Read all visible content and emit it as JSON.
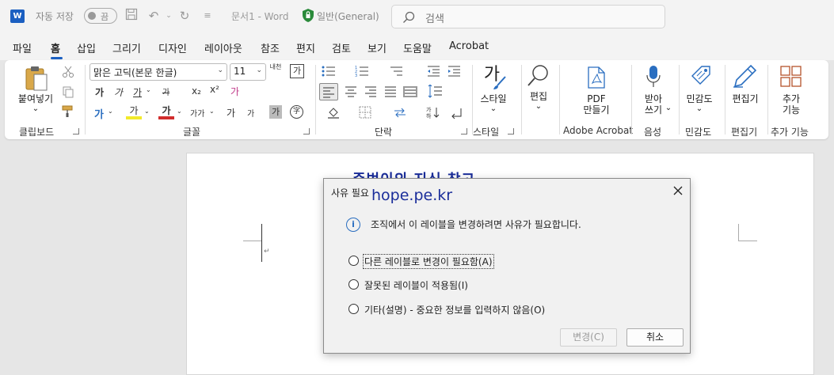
{
  "titlebar": {
    "app_icon_letter": "W",
    "autosave_label": "자동 저장",
    "autosave_state": "끔",
    "doc_title": "문서1 - Word",
    "sensitivity_label": "일반(General)",
    "search_placeholder": "검색"
  },
  "menu": {
    "tabs": [
      "파일",
      "홈",
      "삽입",
      "그리기",
      "디자인",
      "레이아웃",
      "참조",
      "편지",
      "검토",
      "보기",
      "도움말",
      "Acrobat"
    ],
    "active_tab": "홈"
  },
  "ribbon": {
    "clipboard": {
      "paste_label": "붙여넣기",
      "paste_arrow": "⌄",
      "group_label": "클립보드"
    },
    "font": {
      "font_name": "맑은 고딕(본문 한글)",
      "font_size": "11",
      "phonetic": "내천",
      "char_box": "가",
      "bold": "가",
      "italic": "가",
      "underline": "가",
      "strike": "가",
      "subscript": "x₂",
      "superscript": "x²",
      "clear_format": "가",
      "text_effect": "가",
      "highlight": "가",
      "font_color": "가",
      "char_spacing": "가가",
      "grow": "가",
      "shrink": "가",
      "shading": "가",
      "enclose": "字",
      "group_label": "글꼴"
    },
    "paragraph": {
      "group_label": "단락"
    },
    "styles": {
      "style_label": "스타일",
      "style_glyph": "가",
      "group_label": "스타일"
    },
    "editing": {
      "label": "편집"
    },
    "adobe": {
      "pdf_label_1": "PDF",
      "pdf_label_2": "만들기",
      "group_label": "Adobe Acrobat"
    },
    "voice": {
      "dictate_1": "받아",
      "dictate_2": "쓰기",
      "group_label": "음성"
    },
    "sensitivity": {
      "label": "민감도",
      "group_label": "민감도"
    },
    "editor": {
      "label": "편집기",
      "group_label": "편집기"
    },
    "addins": {
      "label_1": "추가",
      "label_2": "기능",
      "group_label": "추가 기능"
    }
  },
  "watermark": {
    "line1": "준범이의 지식 창고..",
    "line2": "hope.pe.kr"
  },
  "dialog": {
    "title": "사유 필요",
    "message": "조직에서 이 레이블을 변경하려면 사유가 필요합니다.",
    "options": [
      "다른 레이블로 변경이 필요함(A)",
      "잘못된 레이블이 적용됨(I)",
      "기타(설명) - 중요한 정보를 입력하지 않음(O)"
    ],
    "ok_label": "변경(C)",
    "cancel_label": "취소"
  },
  "colors": {
    "accent": "#1b5fc1",
    "watermark": "#1a2d9a",
    "info": "#2a6ec0"
  }
}
